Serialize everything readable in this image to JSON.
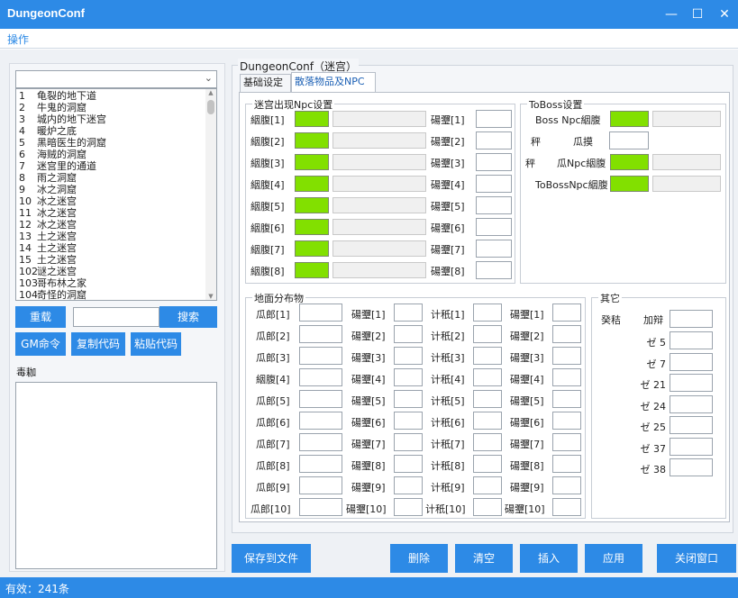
{
  "window": {
    "title": "DungeonConf"
  },
  "menu": {
    "operate": "操作"
  },
  "left": {
    "items": [
      {
        "no": "1",
        "name": "龟裂的地下道"
      },
      {
        "no": "2",
        "name": "牛鬼的洞窟"
      },
      {
        "no": "3",
        "name": "城内的地下迷宫"
      },
      {
        "no": "4",
        "name": "暖炉之底"
      },
      {
        "no": "5",
        "name": "黑暗医生的洞窟"
      },
      {
        "no": "6",
        "name": "海贼的洞窟"
      },
      {
        "no": "7",
        "name": "迷宫里的通道"
      },
      {
        "no": "8",
        "name": "雨之洞窟"
      },
      {
        "no": "9",
        "name": "冰之洞窟"
      },
      {
        "no": "10",
        "name": "冰之迷宫"
      },
      {
        "no": "11",
        "name": "冰之迷宫"
      },
      {
        "no": "12",
        "name": "冰之迷宫"
      },
      {
        "no": "13",
        "name": "土之迷宫"
      },
      {
        "no": "14",
        "name": "土之迷宫"
      },
      {
        "no": "15",
        "name": "土之迷宫"
      },
      {
        "no": "102",
        "name": "谜之迷宫"
      },
      {
        "no": "103",
        "name": "哥布林之家"
      },
      {
        "no": "104",
        "name": "奇怪的洞窟"
      }
    ],
    "reload": "重载",
    "search": "搜索",
    "search_value": "",
    "gm": "GM命令",
    "copy": "复制代码",
    "paste": "粘贴代码",
    "log_label": "毒耞"
  },
  "group_title": "DungeonConf（迷宫）",
  "tabs": {
    "basic": "基础设定",
    "drop": "散落物品及NPC"
  },
  "npc": {
    "title": "迷宫出现Npc设置",
    "left_labels": [
      "絪腹[1]",
      "絪腹[2]",
      "絪腹[3]",
      "絪腹[4]",
      "絪腹[5]",
      "絪腹[6]",
      "絪腹[7]",
      "絪腹[8]"
    ],
    "right_labels": [
      "碭瓕[1]",
      "碭瓕[2]",
      "碭瓕[3]",
      "碭瓕[4]",
      "碭瓕[5]",
      "碭瓕[6]",
      "碭瓕[7]",
      "碭瓕[8]"
    ]
  },
  "toboss": {
    "title": "ToBoss设置",
    "row1": "Boss  Npc絪腹",
    "row2a": "秤",
    "row2b": "瓜摸",
    "row3a": "秤",
    "row3b": "瓜Npc絪腹",
    "row4": "ToBossNpc絪腹"
  },
  "ground": {
    "title": "地面分布物",
    "c1": [
      "瓜郎[1]",
      "瓜郎[2]",
      "瓜郎[3]",
      "絪腹[4]",
      "瓜郎[5]",
      "瓜郎[6]",
      "瓜郎[7]",
      "瓜郎[8]",
      "瓜郎[9]",
      "瓜郎[10]"
    ],
    "c2": [
      "碭瓕[1]",
      "碭瓕[2]",
      "碭瓕[3]",
      "碭瓕[4]",
      "碭瓕[5]",
      "碭瓕[6]",
      "碭瓕[7]",
      "碭瓕[8]",
      "碭瓕[9]",
      "碭瓕[10]"
    ],
    "c3": [
      "计秖[1]",
      "计秖[2]",
      "计秖[3]",
      "计秖[4]",
      "计秖[5]",
      "计秖[6]",
      "计秖[7]",
      "计秖[8]",
      "计秖[9]",
      "计秖[10]"
    ],
    "c4": [
      "碭瓕[1]",
      "碭瓕[2]",
      "碭瓕[3]",
      "碭瓕[4]",
      "碭瓕[5]",
      "碭瓕[6]",
      "碭瓕[7]",
      "碭瓕[8]",
      "碭瓕[9]",
      "碭瓕[10]"
    ]
  },
  "other": {
    "title": "其它",
    "head_a": "癸秸",
    "head_b": "加辩",
    "rows": [
      "ゼ  5",
      "ゼ  7",
      "ゼ  21",
      "ゼ  24",
      "ゼ  25",
      "ゼ  37",
      "ゼ  38"
    ]
  },
  "buttons": {
    "save": "保存到文件",
    "delete": "删除",
    "clear": "清空",
    "insert": "插入",
    "apply": "应用",
    "close": "关闭窗口"
  },
  "status": "有效：241条"
}
